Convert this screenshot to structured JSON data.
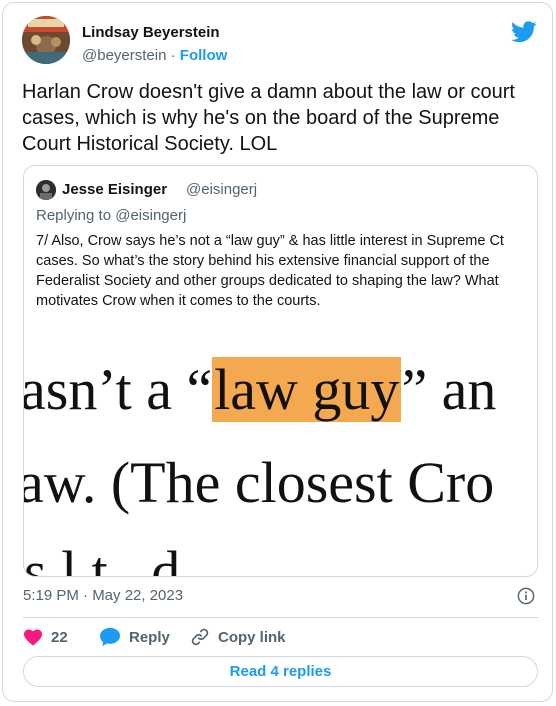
{
  "author": {
    "name": "Lindsay Beyerstein",
    "handle": "@beyerstein",
    "separator": "·",
    "follow_label": "Follow"
  },
  "tweet": {
    "text": "Harlan Crow doesn't give a damn about the law or court cases, which is why he's on the board of the Supreme Court Historical Society. LOL"
  },
  "quoted": {
    "name": "Jesse Eisinger",
    "handle": "@eisingerj",
    "replying_to": "Replying to @eisingerj",
    "text": "7/ Also, Crow says he’s not a “law guy” & has little interest in Supreme Ct cases. So what’s the story behind his extensive financial support of the Federalist Society and other groups dedicated to shaping the law? What motivates Crow when it comes to the courts.",
    "image_text": {
      "line1_before": "asn’t a “",
      "line1_highlight": "law guy",
      "line1_after": "” an",
      "line2": "aw. (The closest Cro",
      "line3": "s       l           t   ,  d ,"
    }
  },
  "timestamp": "5:19 PM · May 22, 2023",
  "actions": {
    "like_count": "22",
    "reply_label": "Reply",
    "copy_label": "Copy link"
  },
  "read_replies_label": "Read 4 replies",
  "colors": {
    "accent": "#1d9bf0",
    "like": "#f91880",
    "highlight": "#f4a950",
    "border": "#cfd9de",
    "muted": "#536471"
  },
  "icons": [
    "twitter-bird-icon",
    "heart-icon",
    "reply-bubble-icon",
    "link-icon",
    "info-icon"
  ]
}
